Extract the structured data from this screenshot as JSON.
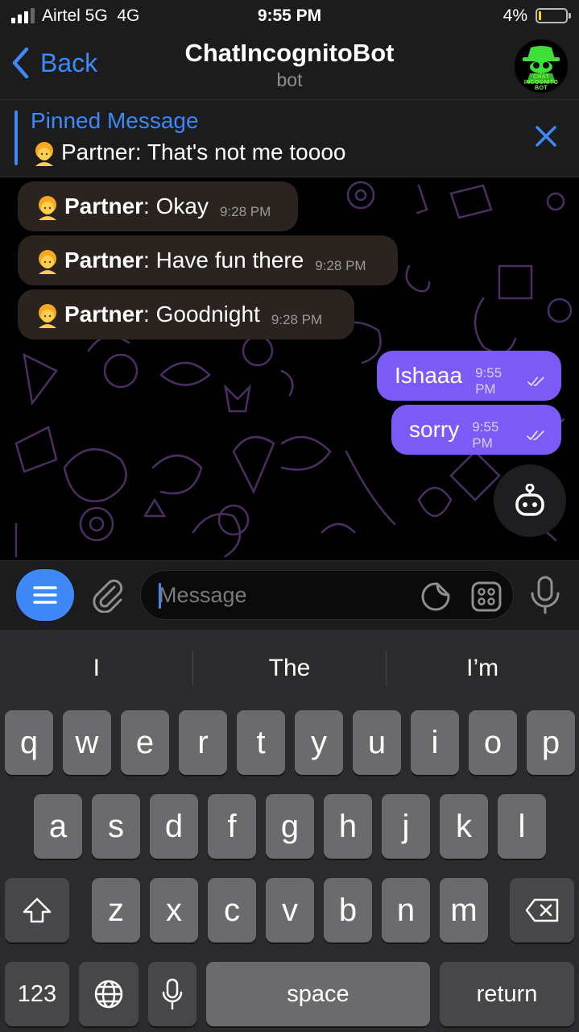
{
  "status_bar": {
    "carrier": "Airtel 5G",
    "network": "4G",
    "time": "9:55 PM",
    "battery": "4%"
  },
  "header": {
    "back_label": "Back",
    "title": "ChatIncognitoBot",
    "subtitle": "bot",
    "avatar_text": "CHAT\nINCOGNITO\nBOT"
  },
  "pinned": {
    "title": "Pinned Message",
    "text": "Partner: That's not me toooo"
  },
  "messages_in": [
    {
      "name": "Partner",
      "text": ": Okay",
      "time": "9:28 PM"
    },
    {
      "name": "Partner",
      "text": ": Have fun there",
      "time": "9:28 PM"
    },
    {
      "name": "Partner",
      "text": ": Goodnight",
      "time": "9:28 PM"
    }
  ],
  "messages_out": [
    {
      "text": "Ishaaa",
      "time": "9:55 PM"
    },
    {
      "text": "sorry",
      "time": "9:55 PM"
    }
  ],
  "input": {
    "placeholder": "Message",
    "value": ""
  },
  "keyboard": {
    "suggestions": [
      "I",
      "The",
      "I’m"
    ],
    "row1": [
      "q",
      "w",
      "e",
      "r",
      "t",
      "y",
      "u",
      "i",
      "o",
      "p"
    ],
    "row2": [
      "a",
      "s",
      "d",
      "f",
      "g",
      "h",
      "j",
      "k",
      "l"
    ],
    "row3": [
      "z",
      "x",
      "c",
      "v",
      "b",
      "n",
      "m"
    ],
    "numbers_key": "123",
    "space_key": "space",
    "return_key": "return"
  },
  "colors": {
    "accent": "#3e88f7",
    "outgoing_bubble": "#7b5af5",
    "incoming_bubble": "#2a2320"
  }
}
